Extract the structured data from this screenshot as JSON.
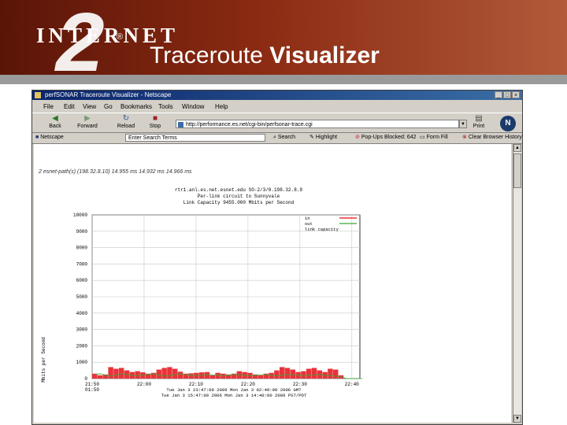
{
  "slide": {
    "logo_text": "INTERNET",
    "logo_registered": "®",
    "logo_numeral": "2",
    "title_regular": "Traceroute",
    "title_bold": "Visualizer"
  },
  "browser": {
    "window_title": "perfSONAR Traceroute Visualizer - Netscape",
    "window_buttons": [
      "_",
      "□",
      "×"
    ],
    "menu": [
      "File",
      "Edit",
      "View",
      "Go",
      "Bookmarks",
      "Tools",
      "Window",
      "Help"
    ],
    "nav": {
      "back": "Back",
      "forward": "Forward",
      "reload": "Reload",
      "stop": "Stop",
      "print": "Print",
      "url": "http://performance.es.net/cgi-bin/perfsonar-trace.cgi"
    },
    "personal_bar": {
      "netscape": "Netscape",
      "select_value": "Enter Search Terms",
      "search": "Search",
      "highlight": "Highlight",
      "popups": "Pop-Ups Blocked: 642",
      "form_fill": "Form Fill",
      "clear_history": "Clear Browser History"
    }
  },
  "content": {
    "path_line": "2 esnet-path(s) (198.32.8.10) 14.955 ms 14.932 ms 14.966 ms",
    "chart_heading": [
      "rtr1.anl.es.net.esnet.edu  SO-2/3/0.198.32.8.9",
      "Per-link circuit to Sunnyvale",
      "Link Capacity 9455.000 Mbits per Second"
    ]
  },
  "chart_data": {
    "type": "area",
    "title": "",
    "xlabel": "",
    "ylabel": "Mbits per Second",
    "ylim": [
      0,
      10000
    ],
    "y_ticks": [
      "0",
      "1000",
      "2000",
      "3000",
      "4000",
      "5000",
      "6000",
      "7000",
      "8000",
      "9000",
      "10000"
    ],
    "x_ticks": [
      "21:50",
      "22:00",
      "22:10",
      "22:20",
      "22:30",
      "22:40"
    ],
    "x_tick_sub": "01:50",
    "x_caption_lines": [
      "Tue Jan  3 23:47:00 2006   Mon Jan  3 02:40:00 2006  GMT",
      "Tue Jan  3 15:47:00 2006   Mon Jan  3 14:40:00 2006  PST/PDT"
    ],
    "legend": [
      "in",
      "out",
      "link capacity"
    ],
    "colors": {
      "in": "#e8333a",
      "out": "#33aa33"
    },
    "x": [
      0,
      1,
      2,
      3,
      4,
      5,
      6,
      7,
      8,
      9,
      10,
      11,
      12,
      13,
      14,
      15,
      16,
      17,
      18,
      19,
      20,
      21,
      22,
      23,
      24,
      25,
      26,
      27,
      28,
      29,
      30,
      31,
      32,
      33,
      34,
      35,
      36,
      37,
      38,
      39,
      40,
      41,
      42,
      43,
      44,
      45,
      46,
      47,
      48,
      49,
      50
    ],
    "series": [
      {
        "name": "in",
        "values": [
          300,
          200,
          250,
          700,
          600,
          650,
          500,
          400,
          450,
          380,
          300,
          350,
          550,
          650,
          700,
          600,
          420,
          300,
          320,
          350,
          380,
          400,
          200,
          350,
          300,
          250,
          300,
          450,
          400,
          350,
          250,
          200,
          300,
          350,
          500,
          700,
          650,
          550,
          400,
          450,
          600,
          650,
          500,
          400,
          600,
          550,
          200,
          0,
          0,
          0,
          0
        ]
      },
      {
        "name": "out",
        "values": [
          250,
          300,
          200,
          150,
          220,
          300,
          250,
          200,
          180,
          220,
          250,
          300,
          200,
          150,
          180,
          250,
          300,
          220,
          200,
          180,
          200,
          250,
          220,
          200,
          180,
          200,
          250,
          220,
          200,
          180,
          200,
          220,
          250,
          200,
          180,
          200,
          250,
          220,
          200,
          180,
          200,
          220,
          250,
          200,
          180,
          150,
          100,
          0,
          0,
          0,
          0
        ]
      }
    ]
  }
}
